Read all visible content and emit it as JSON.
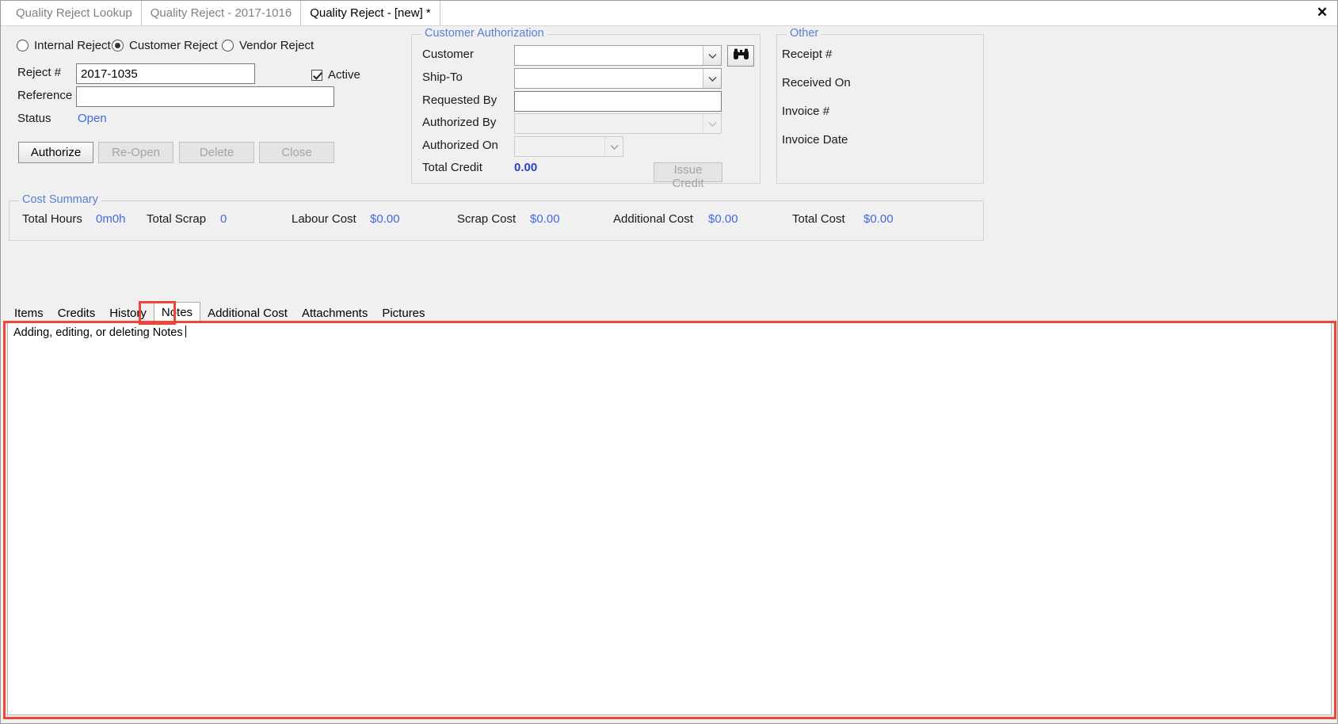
{
  "window": {
    "close_label": "✕"
  },
  "doc_tabs": [
    {
      "label": "Quality Reject Lookup",
      "active": false
    },
    {
      "label": "Quality Reject - 2017-1016",
      "active": false
    },
    {
      "label": "Quality Reject - [new] *",
      "active": true
    }
  ],
  "reject_type": {
    "options": [
      {
        "label": "Internal Reject",
        "selected": false
      },
      {
        "label": "Customer Reject",
        "selected": true
      },
      {
        "label": "Vendor Reject",
        "selected": false
      }
    ]
  },
  "header_form": {
    "reject_no_label": "Reject #",
    "reject_no_value": "2017-1035",
    "reference_label": "Reference",
    "reference_value": "",
    "status_label": "Status",
    "status_value": "Open",
    "active_label": "Active",
    "active_checked": true
  },
  "action_buttons": [
    {
      "label": "Authorize",
      "enabled": true
    },
    {
      "label": "Re-Open",
      "enabled": false
    },
    {
      "label": "Delete",
      "enabled": false
    },
    {
      "label": "Close",
      "enabled": false
    }
  ],
  "customer_authorization": {
    "title": "Customer Authorization",
    "fields": [
      {
        "label": "Customer",
        "value": "",
        "type": "combo",
        "enabled": true
      },
      {
        "label": "Ship-To",
        "value": "",
        "type": "combo",
        "enabled": true
      },
      {
        "label": "Requested By",
        "value": "",
        "type": "text",
        "enabled": true
      },
      {
        "label": "Authorized By",
        "value": "",
        "type": "combo",
        "enabled": false
      },
      {
        "label": "Authorized On",
        "value": "",
        "type": "combo",
        "enabled": false
      }
    ],
    "total_credit_label": "Total Credit",
    "total_credit_value": "0.00",
    "issue_credit_label": "Issue Credit",
    "issue_credit_enabled": false,
    "search_icon": "binoculars-icon"
  },
  "other_panel": {
    "title": "Other",
    "fields": [
      {
        "label": "Receipt #",
        "value": ""
      },
      {
        "label": "Received On",
        "value": ""
      },
      {
        "label": "Invoice #",
        "value": ""
      },
      {
        "label": "Invoice Date",
        "value": ""
      }
    ]
  },
  "cost_summary": {
    "title": "Cost Summary",
    "items": [
      {
        "label": "Total Hours",
        "value": "0m0h"
      },
      {
        "label": "Total Scrap",
        "value": "0"
      },
      {
        "label": "Labour Cost",
        "value": "$0.00"
      },
      {
        "label": "Scrap Cost",
        "value": "$0.00"
      },
      {
        "label": "Additional Cost",
        "value": "$0.00"
      },
      {
        "label": "Total Cost",
        "value": "$0.00"
      }
    ]
  },
  "detail_tabs": [
    {
      "label": "Items",
      "selected": false
    },
    {
      "label": "Credits",
      "selected": false
    },
    {
      "label": "History",
      "selected": false
    },
    {
      "label": "Notes",
      "selected": true
    },
    {
      "label": "Additional Cost",
      "selected": false
    },
    {
      "label": "Attachments",
      "selected": false
    },
    {
      "label": "Pictures",
      "selected": false
    }
  ],
  "notes_panel": {
    "text": "Adding, editing, or deleting Notes"
  },
  "colors": {
    "accent_blue": "#4169e1",
    "group_title_blue": "#5b7fd4",
    "highlight_red": "#f04438",
    "window_bg": "#f0f0f0"
  }
}
